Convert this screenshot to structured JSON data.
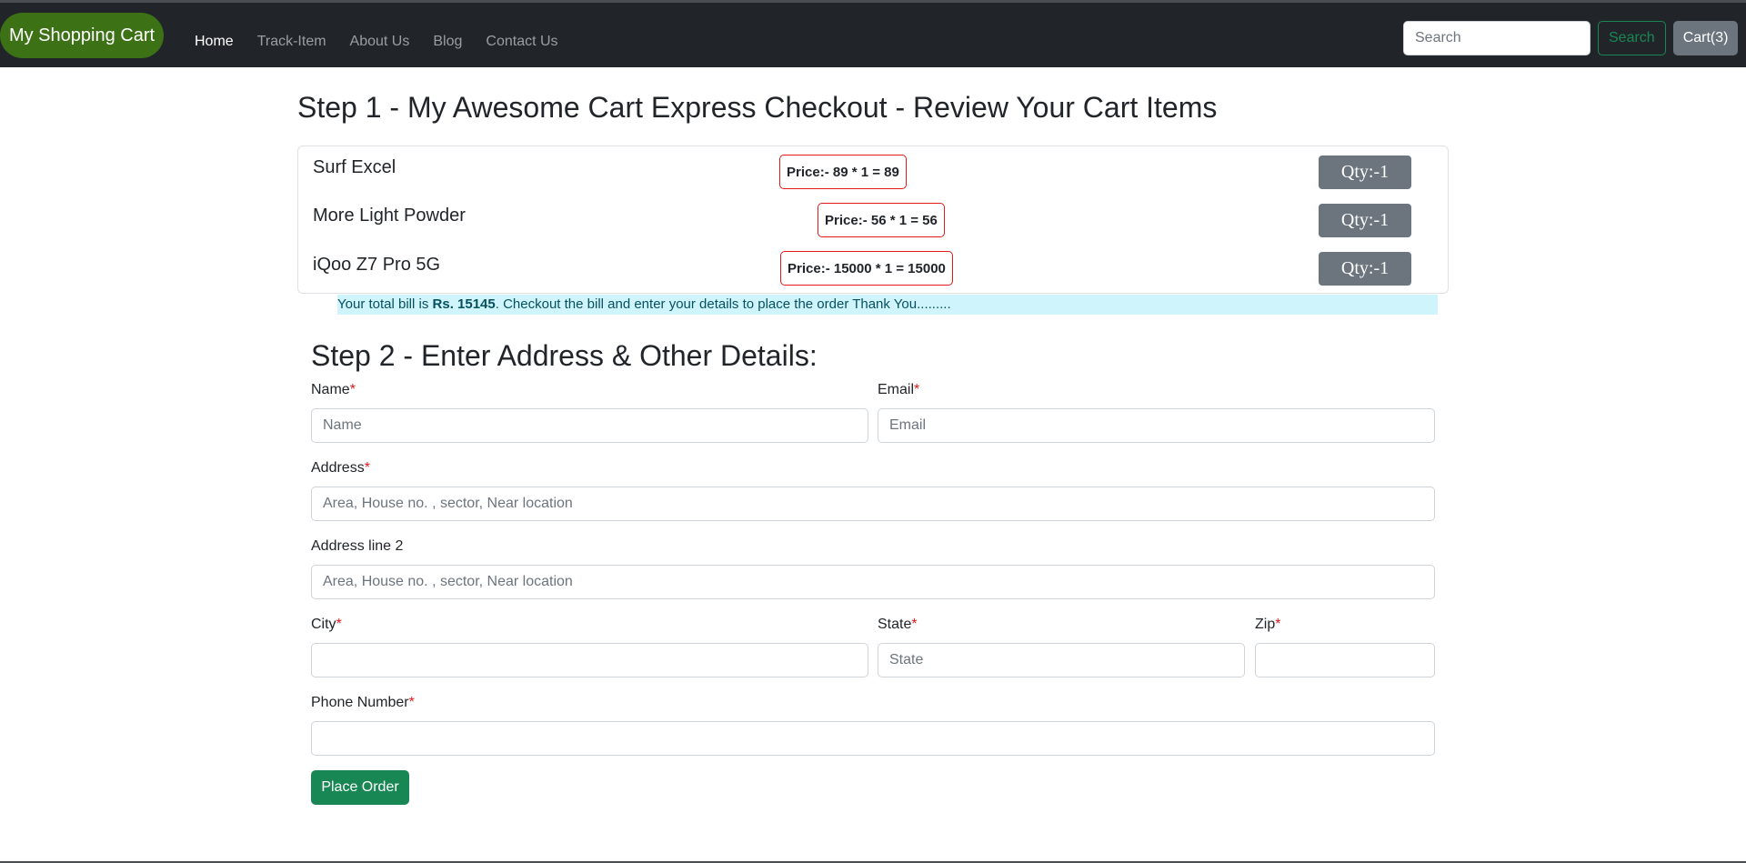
{
  "navbar": {
    "brand": "My Shopping Cart",
    "links": [
      {
        "label": "Home",
        "active": true
      },
      {
        "label": "Track-Item",
        "active": false
      },
      {
        "label": "About Us",
        "active": false
      },
      {
        "label": "Blog",
        "active": false
      },
      {
        "label": "Contact Us",
        "active": false
      }
    ],
    "search_placeholder": "Search",
    "search_button": "Search",
    "cart_button": "Cart(3)"
  },
  "step1": {
    "title": "Step 1 - My Awesome Cart Express Checkout - Review Your Cart Items",
    "items": [
      {
        "name": "Surf Excel",
        "price": "Price:- 89 * 1 = 89",
        "qty": "Qty:-1"
      },
      {
        "name": "More Light Powder",
        "price": "Price:- 56 * 1 = 56",
        "qty": "Qty:-1"
      },
      {
        "name": "iQoo Z7 Pro 5G",
        "price": "Price:- 15000 * 1 = 15000",
        "qty": "Qty:-1"
      }
    ],
    "total_prefix": "Your total bill is ",
    "total_amount": "Rs. 15145",
    "total_suffix": ". Checkout the bill and enter your details to place the order Thank You........."
  },
  "step2": {
    "title": "Step 2 - Enter Address & Other Details:",
    "required_mark": "*",
    "fields": {
      "name": {
        "label": "Name",
        "placeholder": "Name"
      },
      "email": {
        "label": "Email",
        "placeholder": "Email"
      },
      "address": {
        "label": "Address",
        "placeholder": "Area, House no. , sector, Near location"
      },
      "address2": {
        "label": "Address line 2",
        "placeholder": "Area, House no. , sector, Near location"
      },
      "city": {
        "label": "City",
        "placeholder": ""
      },
      "state": {
        "label": "State",
        "placeholder": "State"
      },
      "zip": {
        "label": "Zip",
        "placeholder": ""
      },
      "phone": {
        "label": "Phone Number",
        "placeholder": ""
      }
    },
    "submit": "Place Order"
  },
  "colors": {
    "navbar_bg": "#212529",
    "brand_bg": "#3c7215",
    "success": "#198754",
    "secondary": "#6c757d",
    "price_border": "#e01919",
    "alert_bg": "#cff4fc",
    "alert_text": "#055160"
  }
}
